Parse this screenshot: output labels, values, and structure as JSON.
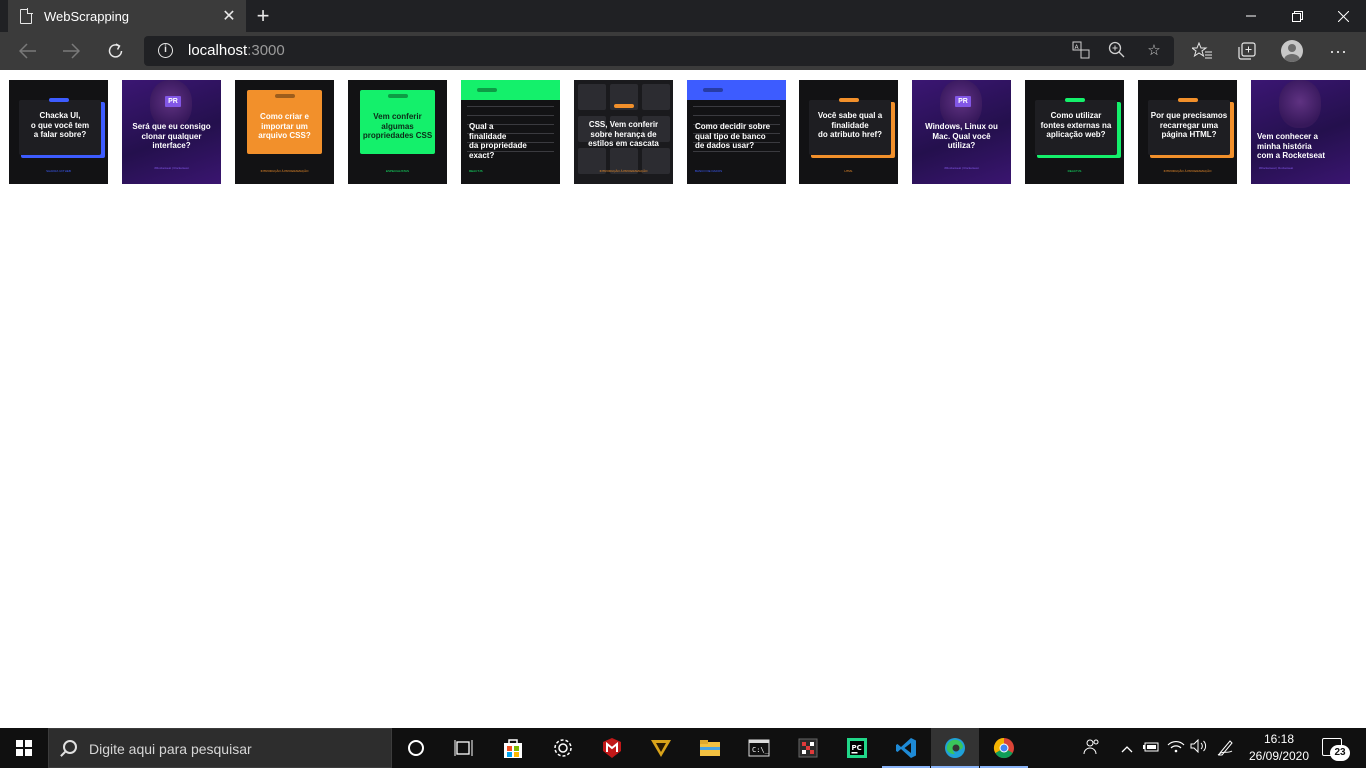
{
  "browser": {
    "tab_title": "WebScrapping",
    "tab_close": "✕",
    "new_tab": "+",
    "url_host": "localhost",
    "url_port": ":3000",
    "more_menu": "···"
  },
  "cards": [
    {
      "text": "Chacka UI,\no que você tem\na falar sobre?",
      "accent": "#3d5cff",
      "footer": "SHAKRA UI/THEB",
      "style": "box-dark"
    },
    {
      "text": "Será que eu consigo\nclonar qualquer\ninterface?",
      "accent": "#8257e6",
      "footer": "#Rocketseat  |  Rocketseat",
      "style": "purple-pr"
    },
    {
      "text": "Como criar e\nimportar um\narquivo CSS?",
      "accent": "#f2902b",
      "footer": "INTRODUÇÃO À PROGRAMAÇÃO",
      "style": "solid"
    },
    {
      "text": "Vem conferir\nalgumas\npropriedades CSS",
      "accent": "#14f06b",
      "footer": "ESPECIALISTAS",
      "style": "solid"
    },
    {
      "text": "Qual a\nfinalidade\nda propriedade\nexact?",
      "accent": "#14f06b",
      "footer": "REACTJS",
      "style": "code-top"
    },
    {
      "text": "CSS, Vem conferir\nsobre herança de\nestilos em cascata",
      "accent": "#f2902b",
      "footer": "INTRODUÇÃO À PROGRAMAÇÃO",
      "style": "grid"
    },
    {
      "text": "Como decidir sobre\nqual tipo de banco\nde dados usar?",
      "accent": "#3d5cff",
      "footer": "BANCO DE DADOS",
      "style": "code-top"
    },
    {
      "text": "Você sabe qual a\nfinalidade\ndo atributo href?",
      "accent": "#f2902b",
      "footer": "HTML",
      "style": "box-dark"
    },
    {
      "text": "Windows, Linux ou\nMac. Qual você\nutiliza?",
      "accent": "#8257e6",
      "footer": "#Rocketseat  |  Rocketseat",
      "style": "purple-pr"
    },
    {
      "text": "Como utilizar\nfontes externas na\naplicação web?",
      "accent": "#14f06b",
      "footer": "REACTJS",
      "style": "box-dark"
    },
    {
      "text": "Por que precisamos\nrecarregar uma\npágina HTML?",
      "accent": "#f2902b",
      "footer": "INTRODUÇÃO À PROGRAMAÇÃO",
      "style": "box-dark"
    },
    {
      "text": "Vem conhecer a\nminha história\ncom a Rocketseat",
      "accent": "#8257e6",
      "footer": "#Rocketseat  |  Rocketseat",
      "style": "purple"
    }
  ],
  "pr_badge": "PR",
  "taskbar": {
    "search_placeholder": "Digite aqui para pesquisar",
    "time": "16:18",
    "date": "26/09/2020",
    "notifications": "23"
  }
}
